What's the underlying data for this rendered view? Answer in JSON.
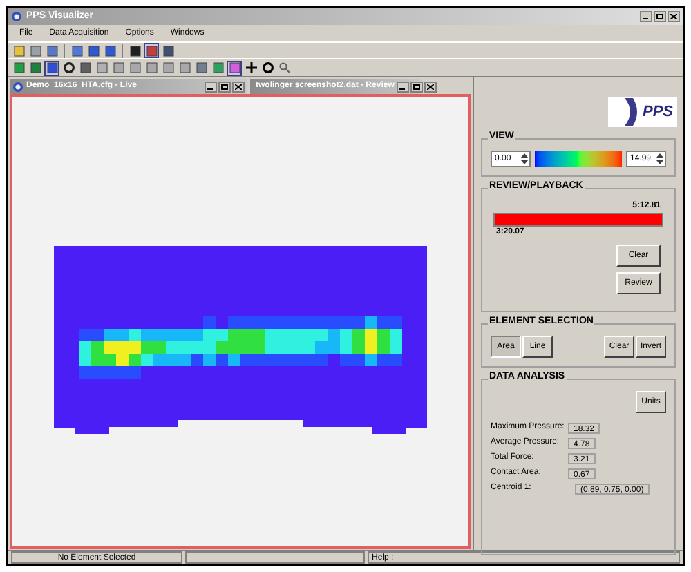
{
  "window": {
    "title": "PPS Visualizer"
  },
  "menu": [
    "File",
    "Data Acquisition",
    "Options",
    "Windows"
  ],
  "documents": [
    {
      "title": "Demo_16x16_HTA.cfg - Live"
    },
    {
      "title": "twolinger screenshot2.dat - Review"
    }
  ],
  "logo": "PPS",
  "view": {
    "title": "VIEW",
    "min": "0.00",
    "max": "14.99"
  },
  "review": {
    "title": "REVIEW/PLAYBACK",
    "end_time": "5:12.81",
    "start_time": "3:20.07",
    "level": 1,
    "buttons": [
      "Clear",
      "Review"
    ]
  },
  "element_selection": {
    "title": "ELEMENT SELECTION",
    "modes": [
      {
        "label": "Area",
        "selected": true
      },
      {
        "label": "Line",
        "selected": false
      }
    ],
    "buttons": [
      "Clear",
      "Invert"
    ]
  },
  "data_analysis": {
    "title": "DATA ANALYSIS",
    "units_button": "Units",
    "rows": [
      {
        "label": "Maximum Pressure:",
        "value": "18.32"
      },
      {
        "label": "Average Pressure:",
        "value": "4.78"
      },
      {
        "label": "Total Force:",
        "value": "3.21"
      },
      {
        "label": "Contact Area:",
        "value": "0.67"
      },
      {
        "label": "Centroid 1:",
        "value": "(0.89, 0.75, 0.00)"
      }
    ]
  },
  "status_bar": {
    "selection": "No Element Selected",
    "help": "Help :"
  }
}
